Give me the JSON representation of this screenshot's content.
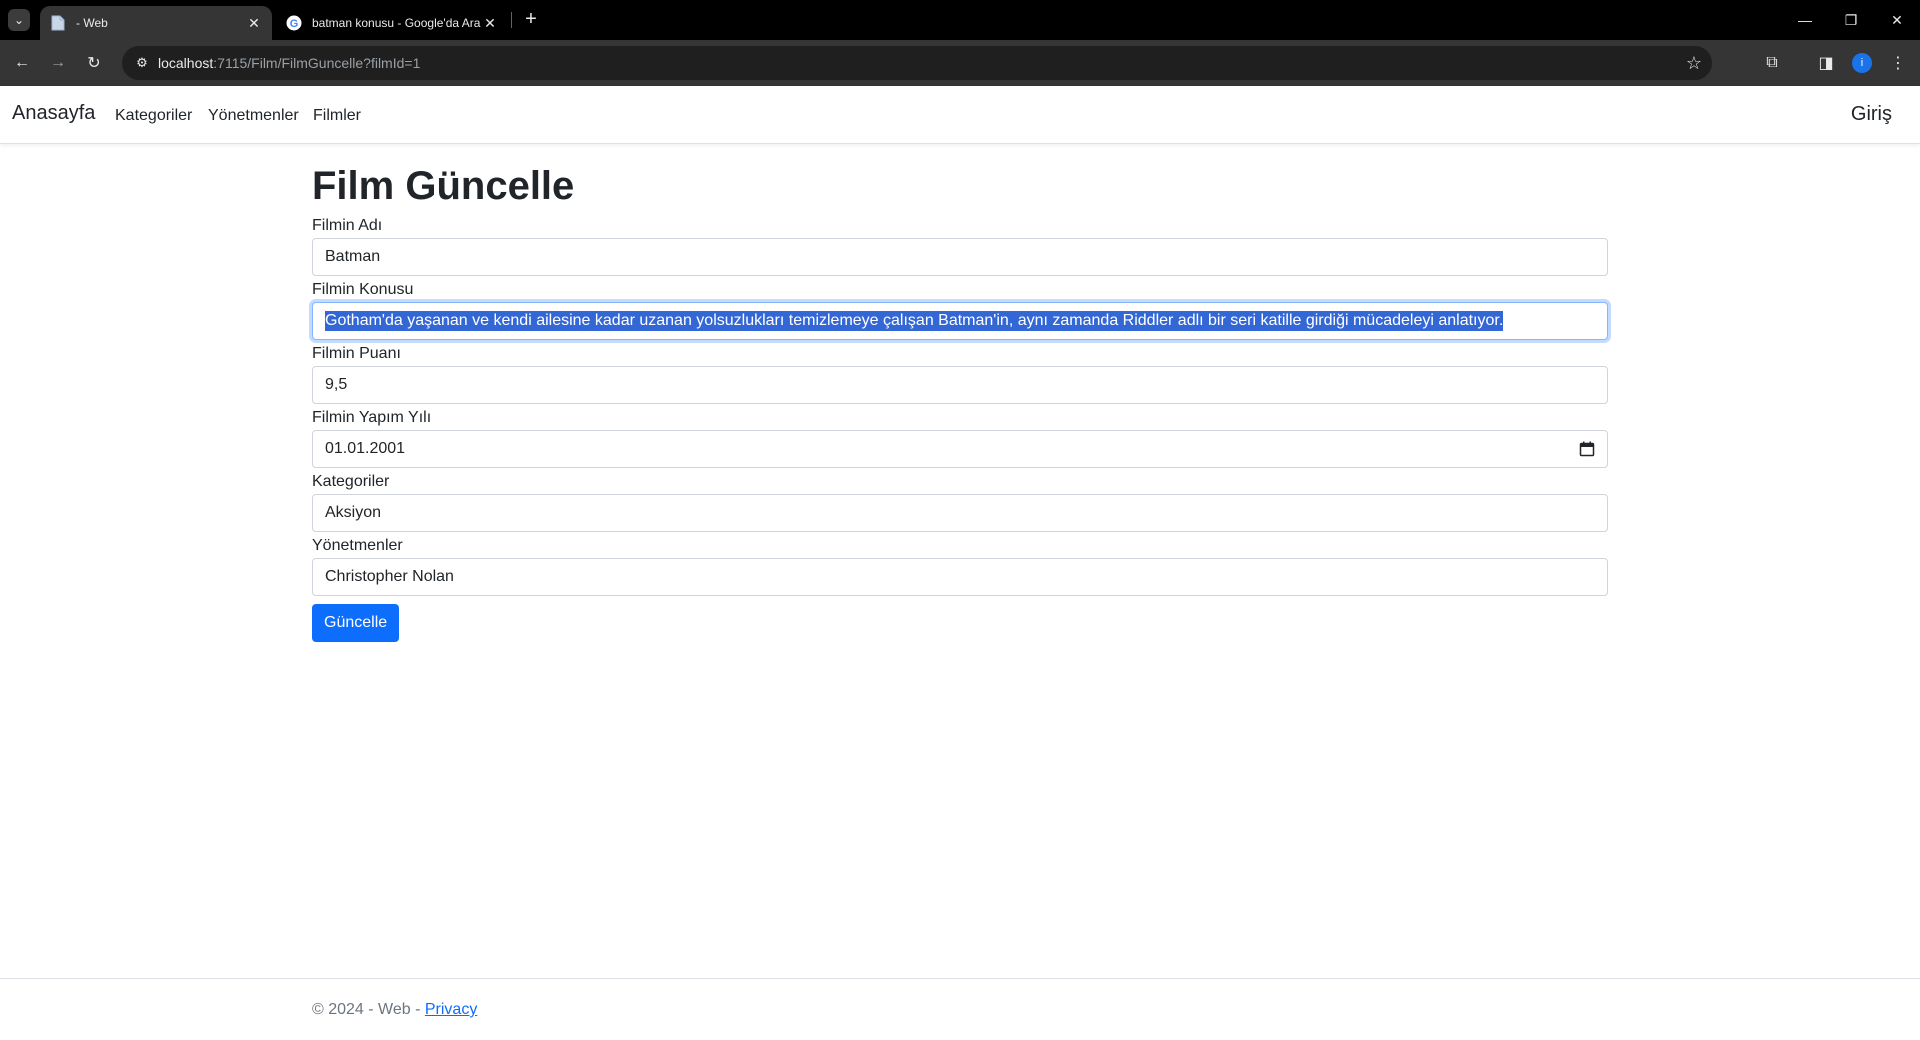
{
  "browser": {
    "tabs": [
      {
        "title": " - Web",
        "active": true
      },
      {
        "title": "batman konusu - Google'da Ara",
        "active": false
      }
    ],
    "url_host": "localhost",
    "url_rest": ":7115/Film/FilmGuncelle?filmId=1",
    "profile_initial": "i"
  },
  "navbar": {
    "brand": "Anasayfa",
    "links": [
      "Kategoriler",
      "Yönetmenler",
      "Filmler"
    ],
    "login": "Giriş"
  },
  "form": {
    "title": "Film Güncelle",
    "fields": [
      {
        "label": "Filmin Adı",
        "value": "Batman"
      },
      {
        "label": "Filmin Konusu",
        "value": "Gotham'da yaşanan ve kendi ailesine kadar uzanan yolsuzlukları temizlemeye çalışan Batman'in, aynı zamanda Riddler adlı bir seri katille girdiği mücadeleyi anlatıyor."
      },
      {
        "label": "Filmin Puanı",
        "value": "9,5"
      },
      {
        "label": "Filmin Yapım Yılı",
        "value": "01.01.2001"
      },
      {
        "label": "Kategoriler",
        "value": "Aksiyon"
      },
      {
        "label": "Yönetmenler",
        "value": "Christopher Nolan"
      }
    ],
    "submit_label": "Güncelle"
  },
  "footer": {
    "text": "© 2024 - Web - ",
    "privacy_link": "Privacy"
  },
  "colors": {
    "primary": "#0d6efd",
    "selection": "#3367d6"
  }
}
